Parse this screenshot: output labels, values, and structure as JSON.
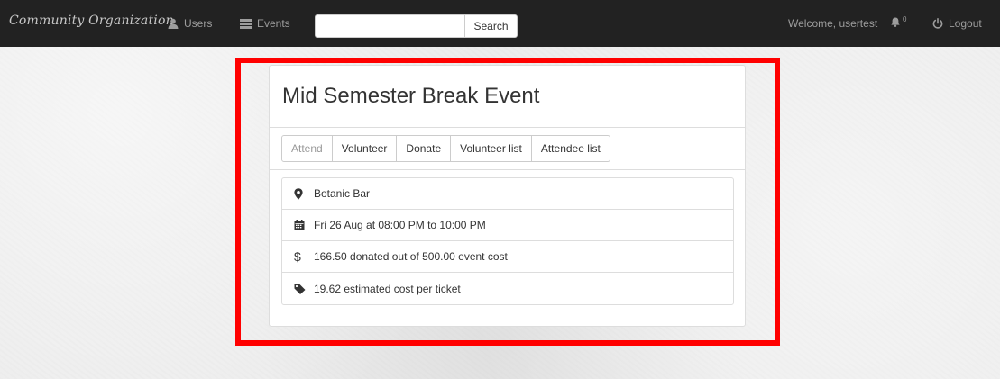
{
  "navbar": {
    "brand": "Community Organization",
    "users_label": "Users",
    "events_label": "Events",
    "search": {
      "value": "",
      "placeholder": "",
      "button_label": "Search"
    },
    "welcome_text": "Welcome, usertest",
    "notification_count": "0",
    "logout_label": "Logout"
  },
  "event": {
    "title": "Mid Semester Break Event",
    "tabs": [
      {
        "label": "Attend",
        "disabled": true
      },
      {
        "label": "Volunteer",
        "disabled": false
      },
      {
        "label": "Donate",
        "disabled": false
      },
      {
        "label": "Volunteer list",
        "disabled": false
      },
      {
        "label": "Attendee list",
        "disabled": false
      }
    ],
    "details": [
      {
        "icon": "map-marker-icon",
        "text": "Botanic Bar"
      },
      {
        "icon": "calendar-icon",
        "text": "Fri 26 Aug at 08:00 PM to 10:00 PM"
      },
      {
        "icon": "dollar-icon",
        "text": "166.50 donated out of 500.00 event cost"
      },
      {
        "icon": "tag-icon",
        "text": "19.62 estimated cost per ticket"
      }
    ]
  },
  "colors": {
    "navbar_bg": "#222222",
    "navbar_text": "#9d9d9d",
    "highlight": "#ff0000"
  }
}
